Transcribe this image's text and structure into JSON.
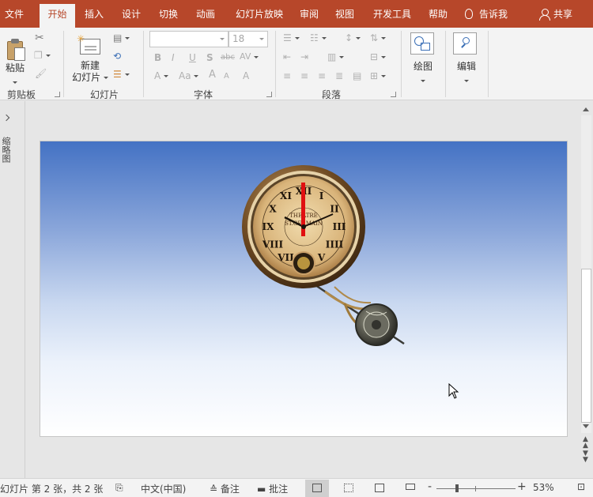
{
  "tabs": [
    {
      "label": "文件",
      "active": false
    },
    {
      "label": "开始",
      "active": true
    },
    {
      "label": "插入",
      "active": false
    },
    {
      "label": "设计",
      "active": false
    },
    {
      "label": "切换",
      "active": false
    },
    {
      "label": "动画",
      "active": false
    },
    {
      "label": "幻灯片放映",
      "active": false
    },
    {
      "label": "审阅",
      "active": false
    },
    {
      "label": "视图",
      "active": false
    },
    {
      "label": "开发工具",
      "active": false
    },
    {
      "label": "帮助",
      "active": false
    }
  ],
  "tell_me": "告诉我",
  "share": "共享",
  "ribbon": {
    "clipboard": {
      "group_label": "剪贴板",
      "paste_label": "粘贴"
    },
    "slides": {
      "group_label": "幻灯片",
      "new_slide_line1": "新建",
      "new_slide_line2": "幻灯片"
    },
    "font": {
      "group_label": "字体",
      "font_name": "",
      "font_size": "18",
      "buttons": {
        "bold": "B",
        "italic": "I",
        "underline": "U",
        "shadow": "S",
        "strike": "abc",
        "spacing": "AV",
        "font_color": "A",
        "case": "Aa",
        "grow": "A",
        "shrink": "A",
        "clear": "A"
      }
    },
    "paragraph": {
      "group_label": "段落"
    },
    "drawing": {
      "label": "绘图"
    },
    "editing": {
      "label": "编辑"
    }
  },
  "left_pane": {
    "label": "缩略图"
  },
  "slide": {
    "clock_text_line1": "THEATRE",
    "clock_text_line2": "ST.GERMAIN",
    "roman": [
      "XII",
      "I",
      "II",
      "III",
      "IIII",
      "V",
      "VI",
      "VII",
      "VIII",
      "IX",
      "X",
      "XI"
    ]
  },
  "status": {
    "slide_info": "幻灯片 第 2 张，共 2 张",
    "language": "中文(中国)",
    "notes": "备注",
    "comments": "批注",
    "zoom": "53%",
    "zoom_minus": "-",
    "zoom_plus": "+"
  },
  "colors": {
    "accent": "#b7472a",
    "ribbon_bg": "#f3f3f3",
    "slide_top": "#4472c4"
  }
}
